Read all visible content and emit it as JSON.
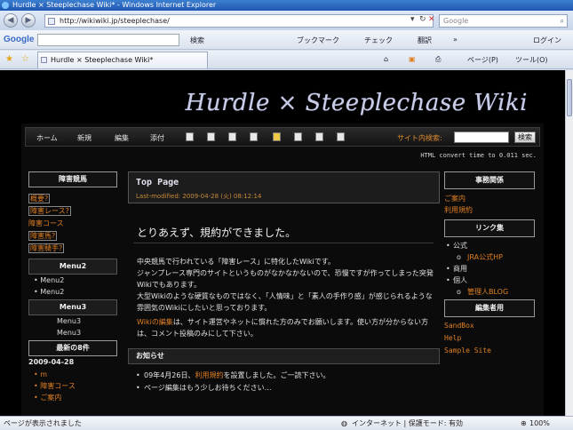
{
  "window": {
    "title": "Hurdle × Steeplechase Wiki* - Windows Internet Explorer"
  },
  "address": {
    "url": "http://wikiwiki.jp/steeplechase/",
    "search_placeholder": "Google"
  },
  "googlebar": {
    "logo": "Google",
    "items": [
      "検索",
      "ブックマーク",
      "チェック",
      "翻訳",
      "»",
      "ログイン"
    ]
  },
  "tabbar": {
    "tab_title": "Hurdle × Steeplechase Wiki*",
    "tools": [
      "ページ(P)",
      "ツール(O)"
    ]
  },
  "site": {
    "title": "Hurdle × Steeplechase Wiki",
    "menu": [
      "ホーム",
      "新規",
      "編集",
      "添付"
    ],
    "search_label": "サイト内検索:",
    "search_button": "検索",
    "convert_time": "HTML convert time to 0.011 sec."
  },
  "left": {
    "head1": "障害競馬",
    "links": [
      "概要?",
      "障害レース?",
      "障害コース",
      "障害馬?",
      "障害騎手?"
    ],
    "head2": "Menu2",
    "menu2": [
      "Menu2",
      "Menu2"
    ],
    "head3": "Menu3",
    "menu3": [
      "Menu3",
      "Menu3"
    ],
    "head4": "最新の8件",
    "date": "2009-04-28",
    "recent": [
      "m",
      "障害コース",
      "ご案内"
    ]
  },
  "main": {
    "page_title": "Top Page",
    "last_modified": "Last-modified: 2009-04-28 (火) 08:12:14",
    "heading": "とりあえず、規約ができました。",
    "p1_line1": "中央競馬で行われている「障害レース」に特化したWikiです。",
    "p1_line2": "ジャンプレース専門のサイトというものがなかなかないので、恐慢ですが作ってしまった突発Wikiでもあります。",
    "p2_line1": "大型Wikiのような硬質なものではなく、「人情味」と「素人の手作り感」が感じられるような雰囲気のWikiにしたいと思っております。",
    "p3_link": "Wikiの編集",
    "p3_rest": "は、サイト運営やネットに慣れた方のみでお願いします。使い方が分からない方は、コメント投稿のみにして下さい。",
    "news_title": "お知らせ",
    "news1_pre": "09年4月26日、",
    "news1_link": "利用規約",
    "news1_post": "を設置しました。ご一読下さい。",
    "news2": "ページ編集はもう少しお待ちください…"
  },
  "right": {
    "head1": "事務関係",
    "links1": [
      "ご案内",
      "利用規約"
    ],
    "head2": "リンク集",
    "official": "公式",
    "jra": "JRA公式HP",
    "commercial": "商用",
    "personal": "個人",
    "admin_blog": "管理人BLOG",
    "head3": "編集者用",
    "links3": [
      "SandBox",
      "Help",
      "Sample Site"
    ]
  },
  "status": {
    "left": "ページが表示されました",
    "zone": "インターネット | 保護モード: 有効",
    "zoom": "100%"
  }
}
